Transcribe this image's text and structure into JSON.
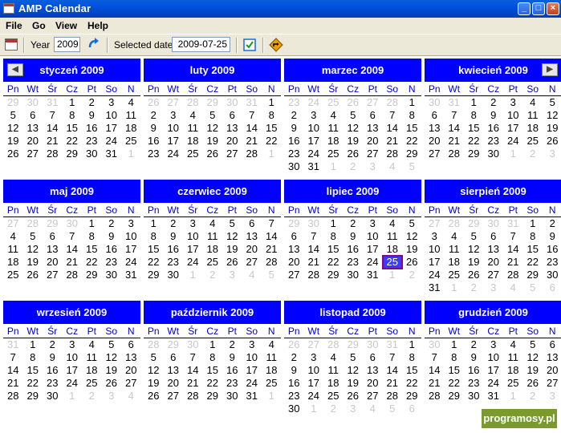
{
  "window": {
    "title": "AMP Calendar"
  },
  "menu": [
    "File",
    "Go",
    "View",
    "Help"
  ],
  "toolbar": {
    "year_label": "Year",
    "year_value": "2009",
    "selected_label": "Selected date",
    "selected_value": "2009-07-25"
  },
  "weekdays": [
    "Pn",
    "Wt",
    "Śr",
    "Cz",
    "Pt",
    "So",
    "N"
  ],
  "selected_day": {
    "month_index": 6,
    "day": 25
  },
  "months": [
    {
      "name": "styczeń 2009",
      "offset": 3,
      "days": 31,
      "prev_days": 31
    },
    {
      "name": "luty 2009",
      "offset": 6,
      "days": 28,
      "prev_days": 31
    },
    {
      "name": "marzec 2009",
      "offset": 6,
      "days": 31,
      "prev_days": 28
    },
    {
      "name": "kwiecień 2009",
      "offset": 2,
      "days": 30,
      "prev_days": 31
    },
    {
      "name": "maj 2009",
      "offset": 4,
      "days": 31,
      "prev_days": 30
    },
    {
      "name": "czerwiec 2009",
      "offset": 0,
      "days": 30,
      "prev_days": 31
    },
    {
      "name": "lipiec 2009",
      "offset": 2,
      "days": 31,
      "prev_days": 30
    },
    {
      "name": "sierpień 2009",
      "offset": 5,
      "days": 31,
      "prev_days": 31
    },
    {
      "name": "wrzesień 2009",
      "offset": 1,
      "days": 30,
      "prev_days": 31
    },
    {
      "name": "październik 2009",
      "offset": 3,
      "days": 31,
      "prev_days": 30
    },
    {
      "name": "listopad 2009",
      "offset": 6,
      "days": 30,
      "prev_days": 31
    },
    {
      "name": "grudzień 2009",
      "offset": 1,
      "days": 31,
      "prev_days": 30
    }
  ],
  "watermark": "programosy.pl"
}
